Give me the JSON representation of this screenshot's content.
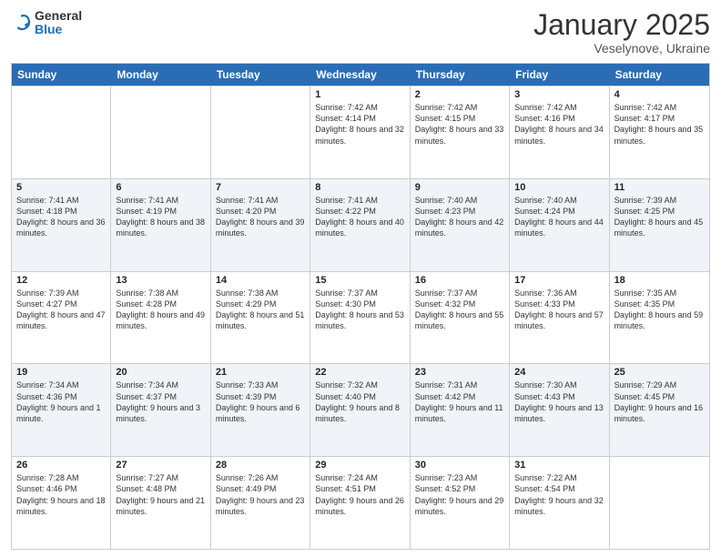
{
  "logo": {
    "general": "General",
    "blue": "Blue"
  },
  "header": {
    "title": "January 2025",
    "subtitle": "Veselynove, Ukraine"
  },
  "days": [
    "Sunday",
    "Monday",
    "Tuesday",
    "Wednesday",
    "Thursday",
    "Friday",
    "Saturday"
  ],
  "weeks": [
    [
      {
        "day": "",
        "text": ""
      },
      {
        "day": "",
        "text": ""
      },
      {
        "day": "",
        "text": ""
      },
      {
        "day": "1",
        "text": "Sunrise: 7:42 AM\nSunset: 4:14 PM\nDaylight: 8 hours and 32 minutes."
      },
      {
        "day": "2",
        "text": "Sunrise: 7:42 AM\nSunset: 4:15 PM\nDaylight: 8 hours and 33 minutes."
      },
      {
        "day": "3",
        "text": "Sunrise: 7:42 AM\nSunset: 4:16 PM\nDaylight: 8 hours and 34 minutes."
      },
      {
        "day": "4",
        "text": "Sunrise: 7:42 AM\nSunset: 4:17 PM\nDaylight: 8 hours and 35 minutes."
      }
    ],
    [
      {
        "day": "5",
        "text": "Sunrise: 7:41 AM\nSunset: 4:18 PM\nDaylight: 8 hours and 36 minutes."
      },
      {
        "day": "6",
        "text": "Sunrise: 7:41 AM\nSunset: 4:19 PM\nDaylight: 8 hours and 38 minutes."
      },
      {
        "day": "7",
        "text": "Sunrise: 7:41 AM\nSunset: 4:20 PM\nDaylight: 8 hours and 39 minutes."
      },
      {
        "day": "8",
        "text": "Sunrise: 7:41 AM\nSunset: 4:22 PM\nDaylight: 8 hours and 40 minutes."
      },
      {
        "day": "9",
        "text": "Sunrise: 7:40 AM\nSunset: 4:23 PM\nDaylight: 8 hours and 42 minutes."
      },
      {
        "day": "10",
        "text": "Sunrise: 7:40 AM\nSunset: 4:24 PM\nDaylight: 8 hours and 44 minutes."
      },
      {
        "day": "11",
        "text": "Sunrise: 7:39 AM\nSunset: 4:25 PM\nDaylight: 8 hours and 45 minutes."
      }
    ],
    [
      {
        "day": "12",
        "text": "Sunrise: 7:39 AM\nSunset: 4:27 PM\nDaylight: 8 hours and 47 minutes."
      },
      {
        "day": "13",
        "text": "Sunrise: 7:38 AM\nSunset: 4:28 PM\nDaylight: 8 hours and 49 minutes."
      },
      {
        "day": "14",
        "text": "Sunrise: 7:38 AM\nSunset: 4:29 PM\nDaylight: 8 hours and 51 minutes."
      },
      {
        "day": "15",
        "text": "Sunrise: 7:37 AM\nSunset: 4:30 PM\nDaylight: 8 hours and 53 minutes."
      },
      {
        "day": "16",
        "text": "Sunrise: 7:37 AM\nSunset: 4:32 PM\nDaylight: 8 hours and 55 minutes."
      },
      {
        "day": "17",
        "text": "Sunrise: 7:36 AM\nSunset: 4:33 PM\nDaylight: 8 hours and 57 minutes."
      },
      {
        "day": "18",
        "text": "Sunrise: 7:35 AM\nSunset: 4:35 PM\nDaylight: 8 hours and 59 minutes."
      }
    ],
    [
      {
        "day": "19",
        "text": "Sunrise: 7:34 AM\nSunset: 4:36 PM\nDaylight: 9 hours and 1 minute."
      },
      {
        "day": "20",
        "text": "Sunrise: 7:34 AM\nSunset: 4:37 PM\nDaylight: 9 hours and 3 minutes."
      },
      {
        "day": "21",
        "text": "Sunrise: 7:33 AM\nSunset: 4:39 PM\nDaylight: 9 hours and 6 minutes."
      },
      {
        "day": "22",
        "text": "Sunrise: 7:32 AM\nSunset: 4:40 PM\nDaylight: 9 hours and 8 minutes."
      },
      {
        "day": "23",
        "text": "Sunrise: 7:31 AM\nSunset: 4:42 PM\nDaylight: 9 hours and 11 minutes."
      },
      {
        "day": "24",
        "text": "Sunrise: 7:30 AM\nSunset: 4:43 PM\nDaylight: 9 hours and 13 minutes."
      },
      {
        "day": "25",
        "text": "Sunrise: 7:29 AM\nSunset: 4:45 PM\nDaylight: 9 hours and 16 minutes."
      }
    ],
    [
      {
        "day": "26",
        "text": "Sunrise: 7:28 AM\nSunset: 4:46 PM\nDaylight: 9 hours and 18 minutes."
      },
      {
        "day": "27",
        "text": "Sunrise: 7:27 AM\nSunset: 4:48 PM\nDaylight: 9 hours and 21 minutes."
      },
      {
        "day": "28",
        "text": "Sunrise: 7:26 AM\nSunset: 4:49 PM\nDaylight: 9 hours and 23 minutes."
      },
      {
        "day": "29",
        "text": "Sunrise: 7:24 AM\nSunset: 4:51 PM\nDaylight: 9 hours and 26 minutes."
      },
      {
        "day": "30",
        "text": "Sunrise: 7:23 AM\nSunset: 4:52 PM\nDaylight: 9 hours and 29 minutes."
      },
      {
        "day": "31",
        "text": "Sunrise: 7:22 AM\nSunset: 4:54 PM\nDaylight: 9 hours and 32 minutes."
      },
      {
        "day": "",
        "text": ""
      }
    ]
  ]
}
